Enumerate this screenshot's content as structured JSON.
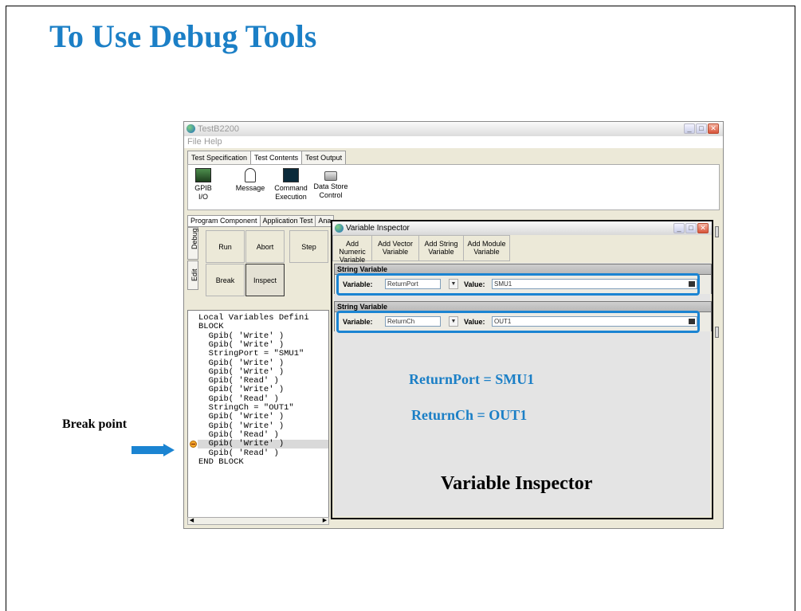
{
  "slide": {
    "title": "To Use Debug Tools",
    "break_point_label": "Break point",
    "inspector_caption": "Variable Inspector"
  },
  "main_window": {
    "title": "TestB2200",
    "menu": [
      "File",
      "Help"
    ],
    "tabs": [
      "Test Specification",
      "Test Contents",
      "Test Output"
    ],
    "active_tab": "Test Contents",
    "tools": [
      {
        "label_1": "GPIB I/O",
        "label_2": "",
        "icon": "gpib-io-icon"
      },
      {
        "label_1": "Message",
        "label_2": "",
        "icon": "message-icon"
      },
      {
        "label_1": "Command",
        "label_2": "Execution",
        "icon": "command-execution-icon"
      },
      {
        "label_1": "Data Store",
        "label_2": "Control",
        "icon": "data-store-icon"
      }
    ],
    "lower_tabs": [
      "Program Component",
      "Application Test",
      "Ana"
    ],
    "side_tabs": [
      "Debug",
      "Edit"
    ],
    "debug_buttons": {
      "run": "Run",
      "abort": "Abort",
      "step": "Step",
      "break": "Break",
      "inspect": "Inspect"
    },
    "code_lines": [
      "Local Variables Defini",
      "BLOCK",
      "  Gpib( 'Write' )",
      "  Gpib( 'Write' )",
      "  StringPort = \"SMU1\"",
      "  Gpib( 'Write' )",
      "  Gpib( 'Write' )",
      "  Gpib( 'Read' )",
      "  Gpib( 'Write' )",
      "  Gpib( 'Read' )",
      "  StringCh = \"OUT1\"",
      "  Gpib( 'Write' )",
      "  Gpib( 'Write' )",
      "  Gpib( 'Read' )",
      "  Gpib( 'Write' )",
      "  Gpib( 'Read' )",
      "END BLOCK"
    ],
    "breakpoint_line_index": 14
  },
  "variable_inspector": {
    "title": "Variable Inspector",
    "toolbar": [
      {
        "line1": "Add Numeric",
        "line2": "Variable"
      },
      {
        "line1": "Add Vector",
        "line2": "Variable"
      },
      {
        "line1": "Add String",
        "line2": "Variable"
      },
      {
        "line1": "Add Module",
        "line2": "Variable"
      }
    ],
    "rows": [
      {
        "header": "String Variable",
        "variable_label": "Variable:",
        "variable": "ReturnPort",
        "value_label": "Value:",
        "value": "SMU1"
      },
      {
        "header": "String Variable",
        "variable_label": "Variable:",
        "variable": "ReturnCh",
        "value_label": "Value:",
        "value": "OUT1"
      }
    ],
    "annotations": [
      "ReturnPort = SMU1",
      "ReturnCh = OUT1"
    ]
  },
  "colors": {
    "accent": "#1b7fc6",
    "highlight_border": "#1b84d2",
    "breakpoint": "#f2a52a"
  }
}
